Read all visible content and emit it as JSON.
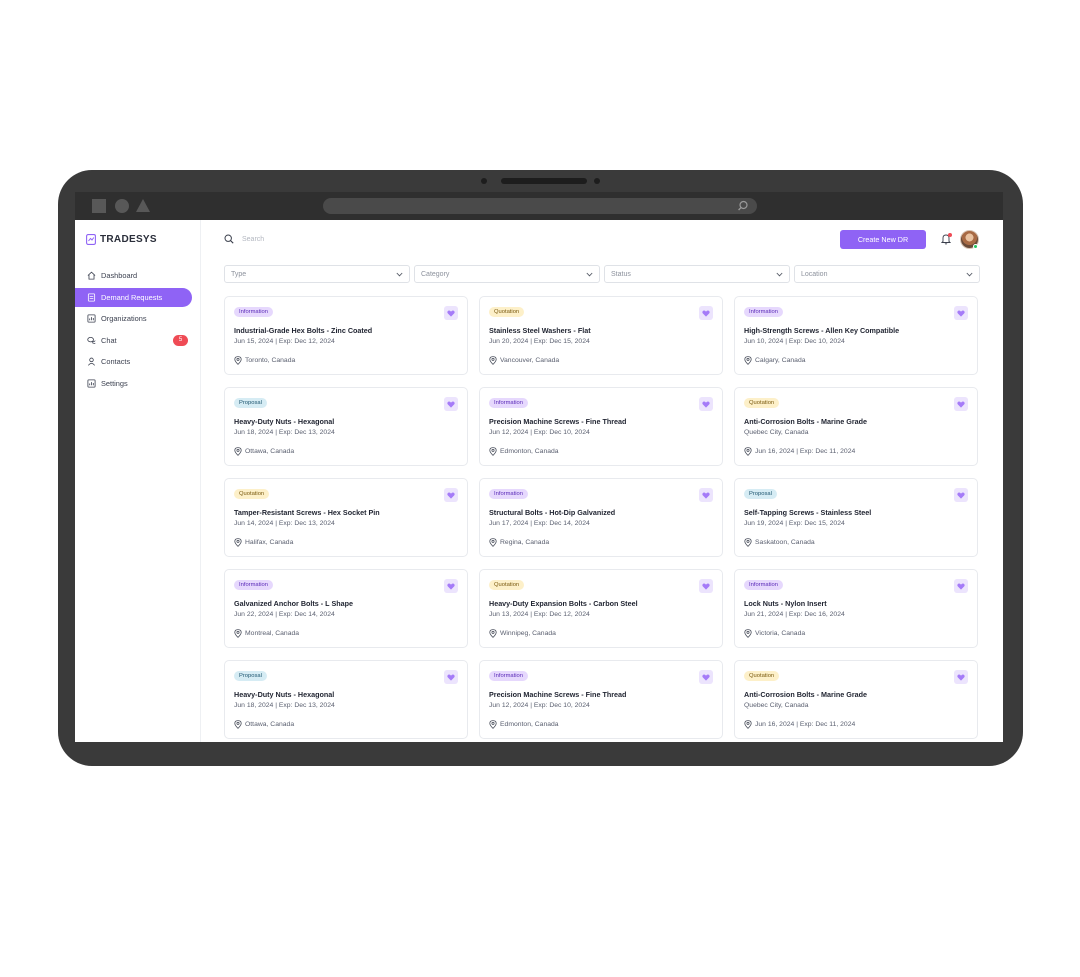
{
  "app": {
    "name": "TRADESYS"
  },
  "sidebar": {
    "items": [
      {
        "label": "Dashboard",
        "icon": "home-icon"
      },
      {
        "label": "Demand Requests",
        "icon": "document-icon",
        "active": true
      },
      {
        "label": "Organizations",
        "icon": "building-icon"
      },
      {
        "label": "Chat",
        "icon": "chat-icon",
        "badge": "5"
      },
      {
        "label": "Contacts",
        "icon": "user-icon"
      },
      {
        "label": "Settings",
        "icon": "settings-icon"
      }
    ]
  },
  "header": {
    "search_placeholder": "Search",
    "create_label": "Create New DR"
  },
  "filters": [
    {
      "label": "Type"
    },
    {
      "label": "Category"
    },
    {
      "label": "Status"
    },
    {
      "label": "Location"
    }
  ],
  "colors": {
    "accent": "#8f63f5",
    "information_tag": "#e6d8fd",
    "quotation_tag": "#fdf0c9",
    "proposal_tag": "#d6ecf4",
    "badge": "#ef4b55"
  },
  "cards": [
    {
      "tag": "Information",
      "title": "Industrial-Grade Hex Bolts - Zinc Coated",
      "dates": "Jun 15, 2024 | Exp: Dec 12, 2024",
      "location": "Toronto, Canada"
    },
    {
      "tag": "Quotation",
      "title": "Stainless Steel Washers - Flat",
      "dates": "Jun 20, 2024 | Exp: Dec 15, 2024",
      "location": "Vancouver, Canada"
    },
    {
      "tag": "Information",
      "title": "High-Strength Screws - Allen Key Compatible",
      "dates": "Jun 10, 2024 | Exp: Dec 10, 2024",
      "location": "Calgary, Canada"
    },
    {
      "tag": "Proposal",
      "title": "Heavy-Duty Nuts - Hexagonal",
      "dates": "Jun 18, 2024 | Exp: Dec 13, 2024",
      "location": "Ottawa, Canada"
    },
    {
      "tag": "Information",
      "title": "Precision Machine Screws - Fine Thread",
      "dates": "Jun 12, 2024 | Exp: Dec 10, 2024",
      "location": "Edmonton, Canada"
    },
    {
      "tag": "Quotation",
      "title": "Anti-Corrosion Bolts - Marine Grade",
      "dates": "Quebec City, Canada",
      "location": "Jun 16, 2024 | Exp: Dec 11, 2024"
    },
    {
      "tag": "Quotation",
      "title": "Tamper-Resistant Screws - Hex Socket Pin",
      "dates": "Jun 14, 2024 | Exp: Dec 13, 2024",
      "location": "Halifax, Canada"
    },
    {
      "tag": "Information",
      "title": "Structural Bolts - Hot-Dip Galvanized",
      "dates": "Jun 17, 2024 | Exp: Dec 14, 2024",
      "location": "Regina, Canada"
    },
    {
      "tag": "Proposal",
      "title": "Self-Tapping Screws - Stainless Steel",
      "dates": "Jun 19, 2024 | Exp: Dec 15, 2024",
      "location": "Saskatoon, Canada"
    },
    {
      "tag": "Information",
      "title": "Galvanized Anchor Bolts - L Shape",
      "dates": "Jun 22, 2024 | Exp: Dec 14, 2024",
      "location": "Montreal, Canada"
    },
    {
      "tag": "Quotation",
      "title": "Heavy-Duty Expansion Bolts - Carbon Steel",
      "dates": "Jun 13, 2024 | Exp: Dec 12, 2024",
      "location": "Winnipeg, Canada"
    },
    {
      "tag": "Information",
      "title": "Lock Nuts - Nylon Insert",
      "dates": "Jun 21, 2024 | Exp: Dec 16, 2024",
      "location": "Victoria, Canada"
    },
    {
      "tag": "Proposal",
      "title": "Heavy-Duty Nuts - Hexagonal",
      "dates": "Jun 18, 2024 | Exp: Dec 13, 2024",
      "location": "Ottawa, Canada"
    },
    {
      "tag": "Information",
      "title": "Precision Machine Screws - Fine Thread",
      "dates": "Jun 12, 2024 | Exp: Dec 10, 2024",
      "location": "Edmonton, Canada"
    },
    {
      "tag": "Quotation",
      "title": "Anti-Corrosion Bolts - Marine Grade",
      "dates": "Quebec City, Canada",
      "location": "Jun 16, 2024 | Exp: Dec 11, 2024"
    }
  ]
}
